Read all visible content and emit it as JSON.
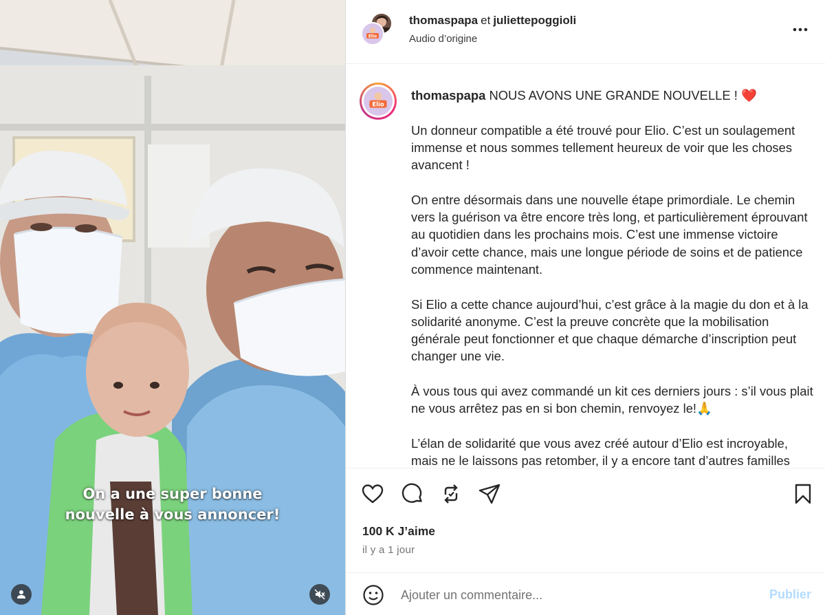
{
  "media": {
    "caption_line1": "On a une super bonne",
    "caption_line2": "nouvelle à vous annoncer!",
    "user_icon": "user-icon",
    "mute_icon": "volume-muted-icon"
  },
  "header": {
    "author1": "thomaspapa",
    "connector": "et",
    "author2": "juliettepoggioli",
    "audio": "Audio d’origine",
    "avatar_badge": "Elio",
    "more_icon": "more-horizontal-icon"
  },
  "post": {
    "username": "thomaspapa",
    "headline": "NOUS AVONS UNE GRANDE NOUVELLE !",
    "headline_emoji": "❤️",
    "paragraphs": [
      "Un donneur compatible a été trouvé pour Elio. C’est un soulagement immense et nous sommes tellement heureux de voir que les choses avancent !",
      "On entre désormais dans une nouvelle étape primordiale. Le chemin vers la guérison va être encore très long, et particulièrement éprouvant au quotidien dans les prochains mois. C’est une immense victoire d’avoir cette chance, mais une longue période de soins et de patience commence maintenant.",
      "Si Elio a cette chance aujourd’hui, c’est grâce à la magie du don et à la solidarité anonyme. C’est la preuve concrète que la mobilisation générale peut fonctionner et que chaque démarche d’inscription peut changer une vie.",
      "À vous tous qui avez commandé un kit ces derniers jours : s’il vous plait ne vous arrêtez pas en si bon chemin, renvoyez le!",
      "L’élan de solidarité que vous avez créé autour d’Elio est incroyable, mais ne le laissons pas retomber, il y a encore tant d’autres familles"
    ],
    "p4_emoji": "🙏"
  },
  "actions": {
    "icons": [
      "heart-icon",
      "comment-icon",
      "repost-icon",
      "share-icon",
      "bookmark-icon"
    ],
    "likes": "100 K J’aime",
    "time": "il y a 1 jour"
  },
  "add_comment": {
    "placeholder": "Ajouter un commentaire...",
    "publish": "Publier",
    "emoji_icon": "emoji-icon"
  },
  "colors": {
    "accent_disabled": "#b3dbff",
    "text": "#262626",
    "muted": "#737373",
    "story_ring": "#ee2a7b"
  }
}
